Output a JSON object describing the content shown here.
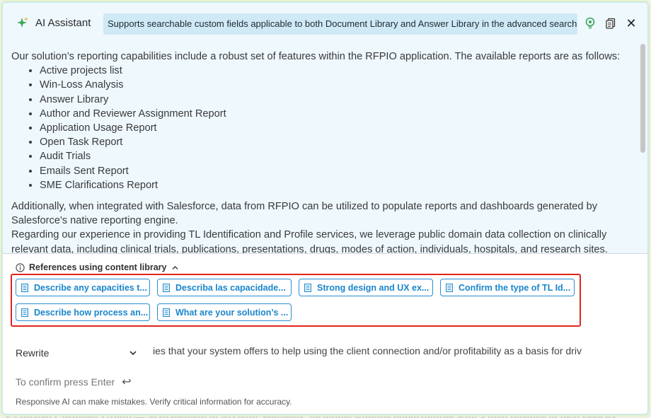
{
  "header": {
    "title": "AI Assistant",
    "banner": "Supports searchable custom fields applicable to both Document Library and Answer Library in the advanced search.",
    "icons": [
      "sparkle-icon",
      "lightbulb-icon",
      "copy-icon",
      "close-icon"
    ],
    "close_glyph": "✕"
  },
  "content": {
    "intro": "Our solution’s reporting capabilities include a robust set of features within the RFPIO application. The available reports are as follows:",
    "reports": [
      "Active projects list",
      "Win-Loss Analysis",
      "Answer Library",
      "Author and Reviewer Assignment Report",
      "Application Usage Report",
      "Open Task Report",
      "Audit Trials",
      "Emails Sent Report",
      "SME Clarifications Report"
    ],
    "paragraph_1": "Additionally, when integrated with Salesforce, data from RFPIO can be utilized to populate reports and dashboards generated by Salesforce's native reporting engine.",
    "paragraph_2": "Regarding our experience in providing TL Identification and Profile services, we leverage public domain data collection on clinically relevant data, including clinical trials, publications, presentations, drugs, modes of action, individuals, hospitals, and research sites."
  },
  "references": {
    "heading": "References using content library",
    "chips": [
      "Describe any capacities t...",
      "Describa las capacidade...",
      "Strong design and UX ex...",
      "Confirm the type of TL Id...",
      "Describe how process an...",
      "What are your solution’s ..."
    ]
  },
  "footer": {
    "rewrite_label": "Rewrite",
    "prompt_text": "ies that your system offers to help using the client connection and/or profitability as a basis for driv",
    "confirm_text": "To confirm press Enter",
    "enter_glyph": "↩",
    "disclaimer": "Responsive AI can make mistakes. Verify critical information for accuracy."
  },
  "background_text": "Evaluated Customer Group — Management of Account Segments, including winning opportunities with a high pipeline of deal velocity",
  "colors": {
    "accent": "#1a86cc",
    "highlight_border": "#e0251b",
    "banner_bg": "#cfe9f6",
    "panel_bg": "#eef8fd"
  }
}
